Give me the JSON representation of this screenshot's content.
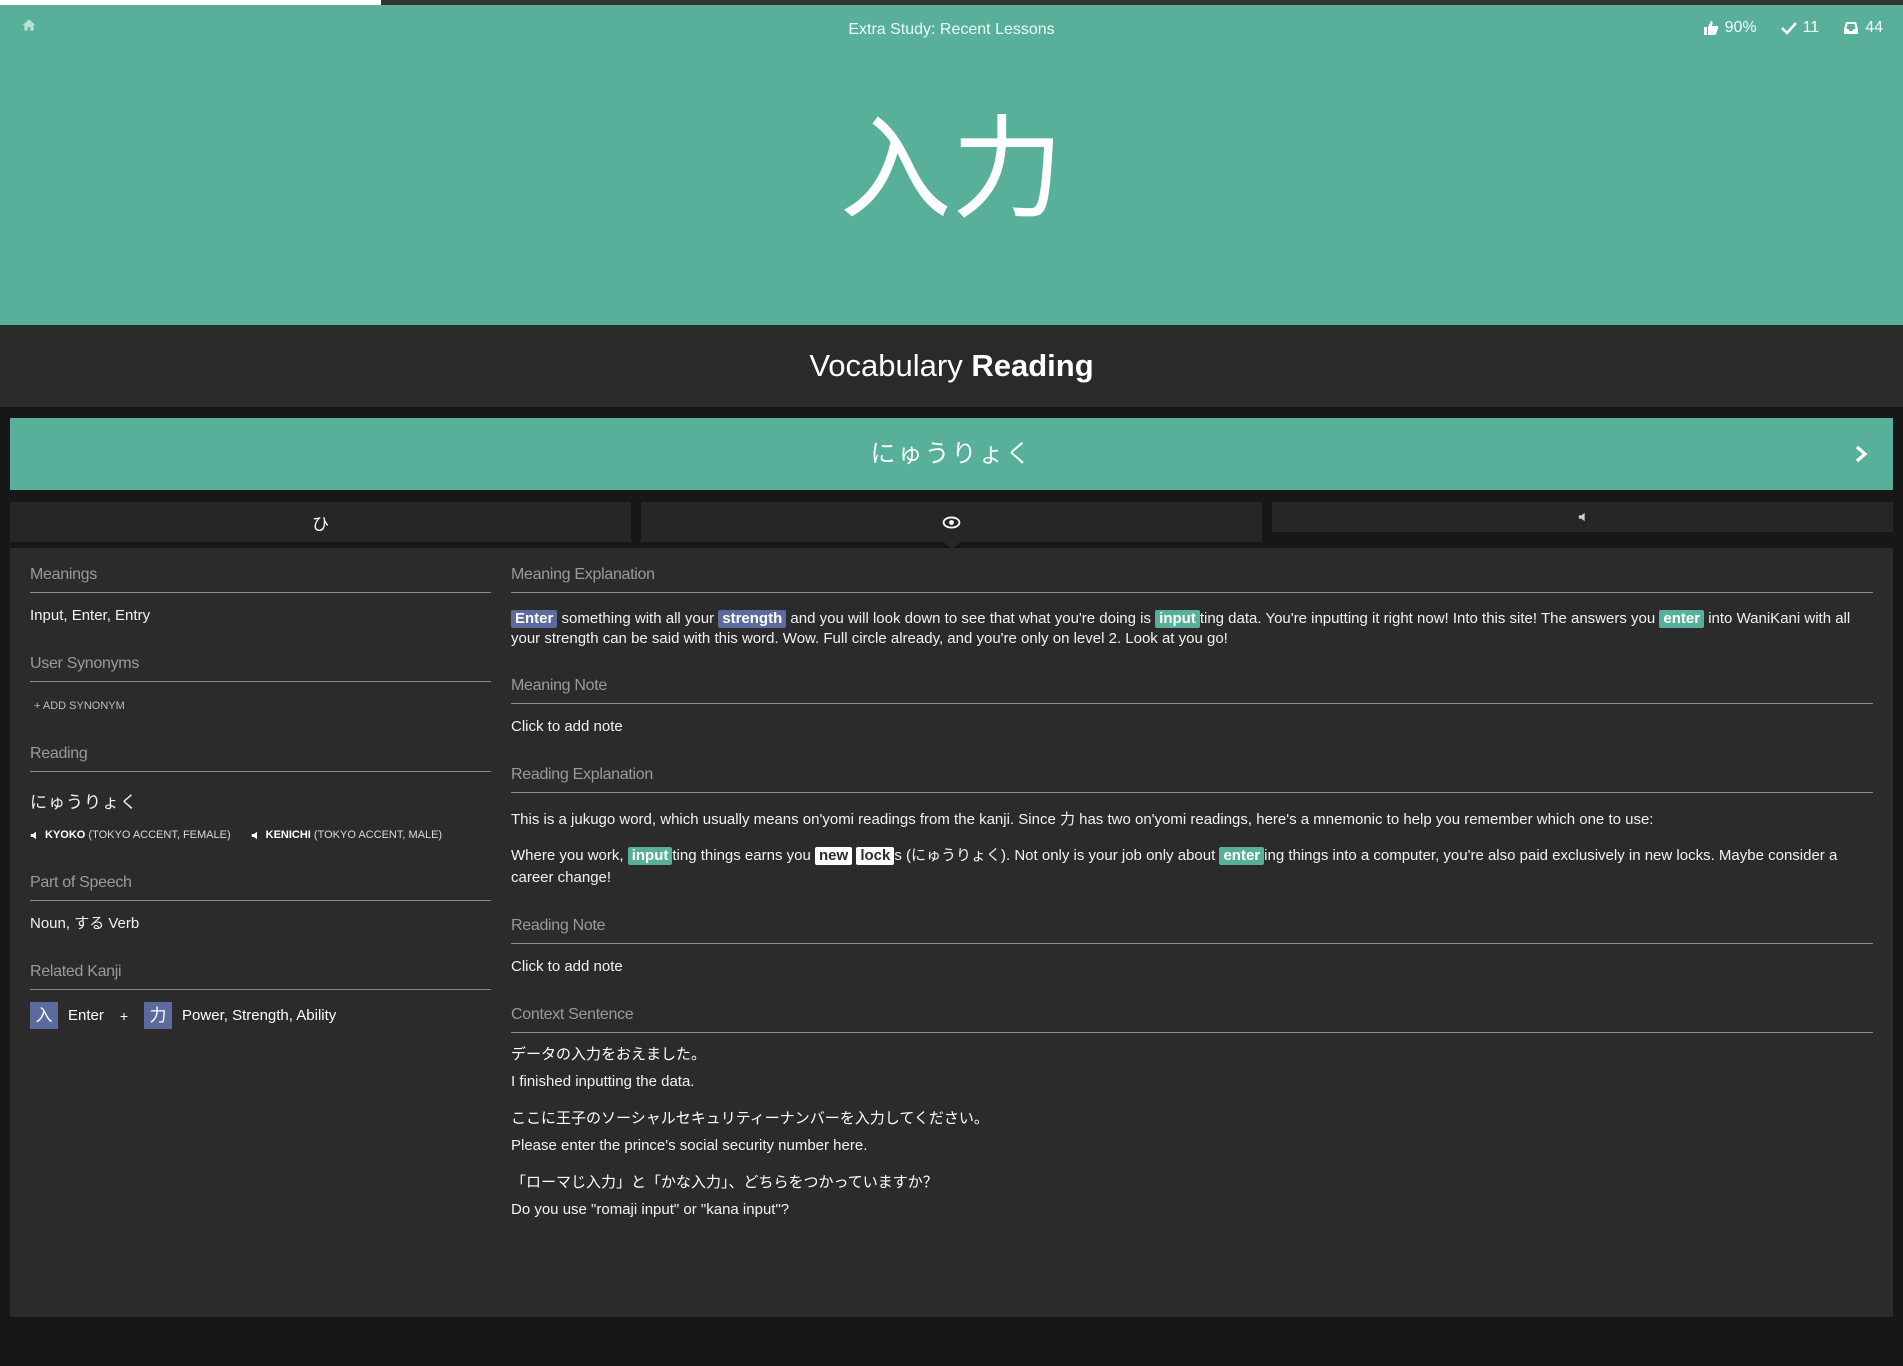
{
  "session": {
    "title": "Extra Study: Recent Lessons",
    "progress_fraction": 0.2,
    "stats": [
      {
        "icon": "thumbs-up-icon",
        "value": "90%"
      },
      {
        "icon": "checkmark-icon",
        "value": "11"
      },
      {
        "icon": "inbox-icon",
        "value": "44"
      }
    ]
  },
  "item": {
    "character": "入力",
    "prompt_type": "Vocabulary",
    "prompt_kind": "Reading",
    "answer": "にゅうりょく"
  },
  "tabs": [
    {
      "icon": "hiragana-icon",
      "label": "ひ"
    },
    {
      "icon": "eye-icon"
    },
    {
      "icon": "speaker-icon"
    }
  ],
  "left": {
    "meanings_head": "Meanings",
    "meanings": "Input, Enter, Entry",
    "synonyms_head": "User Synonyms",
    "add_synonym": "+ ADD SYNONYM",
    "reading_head": "Reading",
    "reading": "にゅうりょく",
    "audio": [
      {
        "name": "KYOKO",
        "detail": "(TOKYO ACCENT, FEMALE)"
      },
      {
        "name": "KENICHI",
        "detail": "(TOKYO ACCENT, MALE)"
      }
    ],
    "pos_head": "Part of Speech",
    "pos": "Noun, する Verb",
    "related_head": "Related Kanji",
    "related": [
      {
        "kanji": "入",
        "meaning": "Enter"
      },
      {
        "kanji": "力",
        "meaning": "Power, Strength, Ability"
      }
    ],
    "plus": "+"
  },
  "right": {
    "meaning_expl_head": "Meaning Explanation",
    "meaning_expl": {
      "hl_enter": "Enter",
      "t1": " something with all your ",
      "hl_strength": "strength",
      "t2": " and you will look down to see that what you're doing is ",
      "hl_input": "input",
      "t3": "ting data. You're inputting it right now! Into this site! The answers you ",
      "hl_enter2": "enter",
      "t4": " into WaniKani with all your strength can be said with this word. Wow. Full circle already, and you're only on level 2. Look at you go!"
    },
    "meaning_note_head": "Meaning Note",
    "meaning_note": "Click to add note",
    "reading_expl_head": "Reading Explanation",
    "reading_expl_p1": "This is a jukugo word, which usually means on'yomi readings from the kanji. Since 力 has two on'yomi readings, here's a mnemonic to help you remember which one to use:",
    "reading_expl_p2": {
      "t1": "Where you work, ",
      "hl_input": "input",
      "t2": "ting things earns you ",
      "hl_new": "new",
      "hl_lock": "lock",
      "t3": "s (にゅうりょく). Not only is your job only about ",
      "hl_enter": "enter",
      "t4": "ing things into a computer, you're also paid exclusively in new locks. Maybe consider a career change!"
    },
    "reading_note_head": "Reading Note",
    "reading_note": "Click to add note",
    "context_head": "Context Sentence",
    "context": [
      {
        "ja": "データの入力をおえました。",
        "en": "I finished inputting the data."
      },
      {
        "ja": "ここに王子のソーシャルセキュリティーナンバーを入力してください。",
        "en": "Please enter the prince's social security number here."
      },
      {
        "ja": "「ローマじ入力」と「かな入力」、どちらをつかっていますか？",
        "en": "Do you use \"romaji input\" or \"kana input\"?"
      }
    ]
  },
  "colors": {
    "accent": "#58b09b",
    "kanji": "#5d6a9e",
    "panel": "#2b2b2b"
  }
}
